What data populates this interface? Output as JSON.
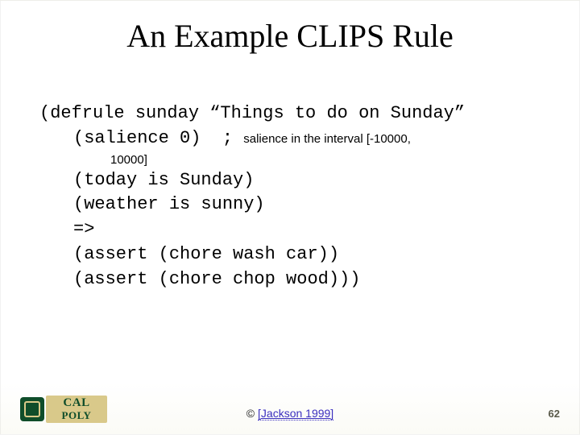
{
  "title": "An Example CLIPS Rule",
  "code": {
    "line1": "(defrule sunday “Things to do on Sunday”",
    "line2_main": "(salience 0)  ; ",
    "line2_note": "salience in the interval [-10000,",
    "line3_note": "10000]",
    "line4": "(today is Sunday)",
    "line5": "(weather is sunny)",
    "line6": "=>",
    "line7": "(assert (chore wash car))",
    "line8": "(assert (chore chop wood)))"
  },
  "citation": {
    "prefix": "© ",
    "link": "[Jackson 1999]"
  },
  "page_number": "62",
  "logo": {
    "line1": "CAL",
    "line2": "POLY"
  }
}
